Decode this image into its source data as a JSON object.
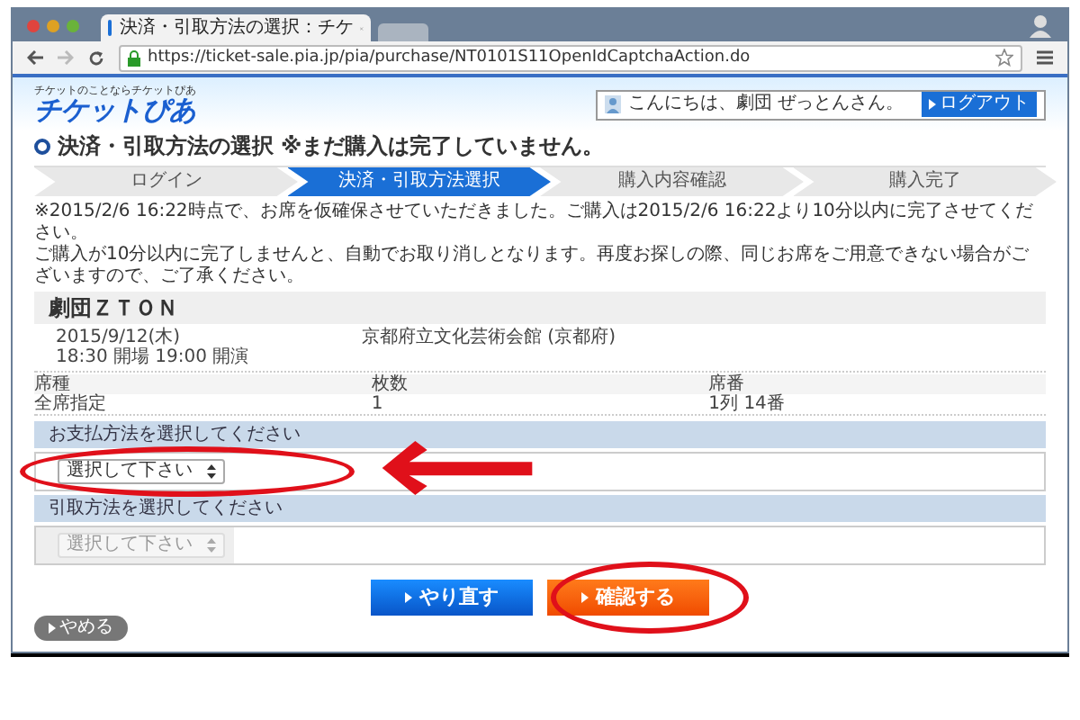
{
  "browser": {
    "tab_title": "決済・引取方法の選択：チケ",
    "url": "https://ticket-sale.pia.jp/pia/purchase/NT0101S11OpenIdCaptchaAction.do"
  },
  "header": {
    "logo_tagline": "チケットのことならチケットぴあ",
    "logo": "チケットぴあ",
    "greeting": "こんにちは、劇団 ぜっとんさん。",
    "logout": "ログアウト"
  },
  "page_title": "決済・引取方法の選択",
  "page_note": "※まだ購入は完了していません。",
  "steps": [
    {
      "label": "ログイン",
      "selected": false
    },
    {
      "label": "決済・引取方法選択",
      "selected": true
    },
    {
      "label": "購入内容確認",
      "selected": false
    },
    {
      "label": "購入完了",
      "selected": false
    }
  ],
  "notice": [
    "※2015/2/6 16:22時点で、お席を仮確保させていただきました。ご購入は2015/2/6 16:22より10分以内に完了させてください。",
    "ご購入が10分以内に完了しませんと、自動でお取り消しとなります。再度お探しの際、同じお席をご用意できない場合がございますので、ご了承ください。"
  ],
  "event": {
    "title": "劇団ＺＴＯＮ",
    "date": "2015/9/12(木)",
    "times": "18:30 開場 19:00 開演",
    "venue": "京都府立文化芸術会館 (京都府)"
  },
  "seats": {
    "columns": [
      "席種",
      "枚数",
      "席番"
    ],
    "values": [
      "全席指定",
      "1",
      "1列 14番"
    ]
  },
  "sections": [
    {
      "label": "お支払方法を選択してください",
      "select": "選択して下さい",
      "disabled": false
    },
    {
      "label": "引取方法を選択してください",
      "select": "選択して下さい",
      "disabled": true
    }
  ],
  "buttons": [
    {
      "label": "やり直す",
      "kind": "secondary"
    },
    {
      "label": "確認する",
      "kind": "primary"
    }
  ],
  "cancel": "やめる"
}
